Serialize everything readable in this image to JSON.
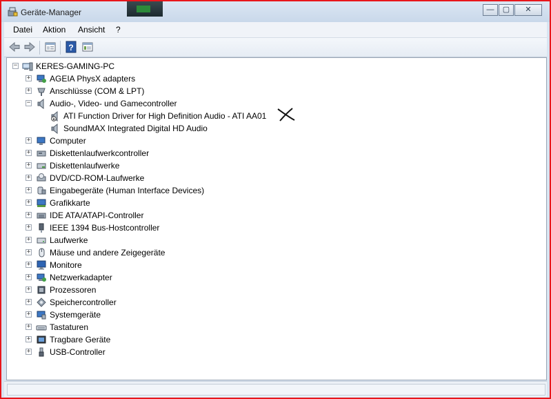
{
  "window": {
    "title": "Geräte-Manager",
    "buttons": {
      "minimize": "—",
      "maximize": "▢",
      "close": "✕"
    }
  },
  "menu": {
    "items": [
      "Datei",
      "Aktion",
      "Ansicht",
      "?"
    ]
  },
  "toolbar": {
    "icons": [
      "back-arrow-icon",
      "forward-arrow-icon",
      "properties-icon",
      "help-icon",
      "view-icon"
    ]
  },
  "tree": {
    "root": "KERES-GAMING-PC",
    "categories": [
      {
        "label": "AGEIA PhysX adapters",
        "icon": "network-adapter-icon",
        "expanded": false
      },
      {
        "label": "Anschlüsse (COM & LPT)",
        "icon": "port-icon",
        "expanded": false
      },
      {
        "label": "Audio-, Video- und Gamecontroller",
        "icon": "speaker-icon",
        "expanded": true,
        "children": [
          {
            "label": "ATI Function Driver for High Definition Audio - ATI AA01",
            "icon": "speaker-disabled-icon",
            "annotation": "handwritten-x"
          },
          {
            "label": "SoundMAX Integrated Digital HD Audio",
            "icon": "speaker-icon"
          }
        ]
      },
      {
        "label": "Computer",
        "icon": "computer-icon",
        "expanded": false
      },
      {
        "label": "Diskettenlaufwerkcontroller",
        "icon": "floppy-controller-icon",
        "expanded": false
      },
      {
        "label": "Diskettenlaufwerke",
        "icon": "floppy-drive-icon",
        "expanded": false
      },
      {
        "label": "DVD/CD-ROM-Laufwerke",
        "icon": "dvd-drive-icon",
        "expanded": false
      },
      {
        "label": "Eingabegeräte (Human Interface Devices)",
        "icon": "hid-icon",
        "expanded": false
      },
      {
        "label": "Grafikkarte",
        "icon": "display-adapter-icon",
        "expanded": false
      },
      {
        "label": "IDE ATA/ATAPI-Controller",
        "icon": "ide-controller-icon",
        "expanded": false
      },
      {
        "label": "IEEE 1394 Bus-Hostcontroller",
        "icon": "firewire-icon",
        "expanded": false
      },
      {
        "label": "Laufwerke",
        "icon": "disk-drive-icon",
        "expanded": false
      },
      {
        "label": "Mäuse und andere Zeigegeräte",
        "icon": "mouse-icon",
        "expanded": false
      },
      {
        "label": "Monitore",
        "icon": "monitor-icon",
        "expanded": false
      },
      {
        "label": "Netzwerkadapter",
        "icon": "network-adapter-icon",
        "expanded": false
      },
      {
        "label": "Prozessoren",
        "icon": "processor-icon",
        "expanded": false
      },
      {
        "label": "Speichercontroller",
        "icon": "storage-controller-icon",
        "expanded": false
      },
      {
        "label": "Systemgeräte",
        "icon": "system-device-icon",
        "expanded": false
      },
      {
        "label": "Tastaturen",
        "icon": "keyboard-icon",
        "expanded": false
      },
      {
        "label": "Tragbare Geräte",
        "icon": "portable-device-icon",
        "expanded": false
      },
      {
        "label": "USB-Controller",
        "icon": "usb-icon",
        "expanded": false
      }
    ]
  },
  "colors": {
    "highlight_border": "#e8161b",
    "chrome": "#d9e4f1"
  }
}
